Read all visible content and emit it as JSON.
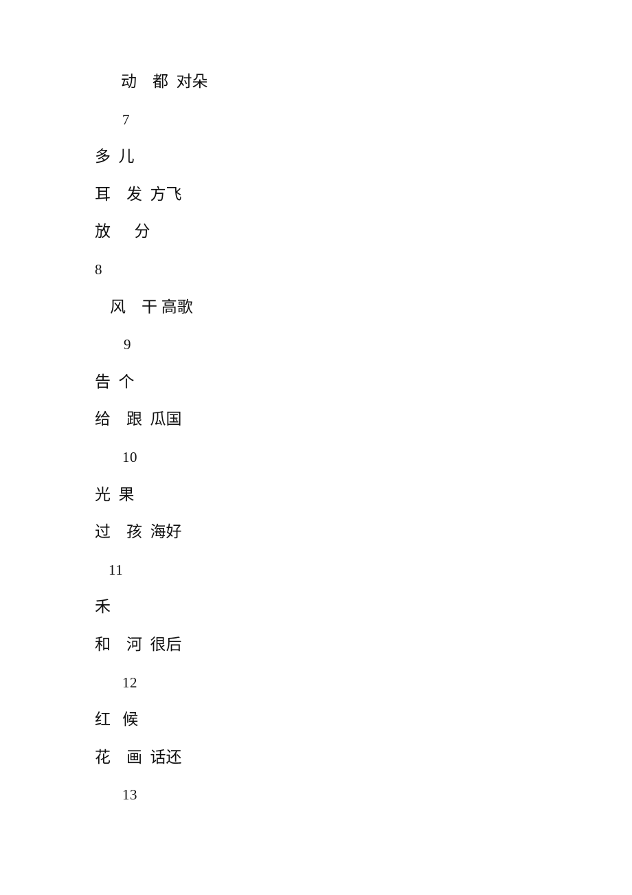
{
  "document": {
    "type": "character-list",
    "page_background": "#ffffff",
    "text_color": "#111111",
    "lines": [
      {
        "id": "line-1",
        "kind": "cjk",
        "indent": "ind-3",
        "text": "动    都  对朵"
      },
      {
        "id": "line-2",
        "kind": "num",
        "indent": "ind-4",
        "text": "7"
      },
      {
        "id": "line-3",
        "kind": "cjk",
        "indent": "ind-0",
        "text": "多  儿"
      },
      {
        "id": "line-4",
        "kind": "cjk",
        "indent": "ind-0",
        "text": "耳    发  方飞"
      },
      {
        "id": "line-5",
        "kind": "cjk",
        "indent": "ind-0",
        "text": "放      分"
      },
      {
        "id": "line-6",
        "kind": "num",
        "indent": "ind-0",
        "text": "8"
      },
      {
        "id": "line-7",
        "kind": "cjk",
        "indent": "ind-2",
        "text": "风    干 高歌"
      },
      {
        "id": "line-8",
        "kind": "num",
        "indent": "ind-5",
        "text": "9"
      },
      {
        "id": "line-9",
        "kind": "cjk",
        "indent": "ind-0",
        "text": "告  个"
      },
      {
        "id": "line-10",
        "kind": "cjk",
        "indent": "ind-0",
        "text": "给    跟  瓜国"
      },
      {
        "id": "line-11",
        "kind": "num",
        "indent": "ind-4",
        "text": "10"
      },
      {
        "id": "line-12",
        "kind": "cjk",
        "indent": "ind-0",
        "text": "光  果"
      },
      {
        "id": "line-13",
        "kind": "cjk",
        "indent": "ind-0",
        "text": "过    孩  海好"
      },
      {
        "id": "line-14",
        "kind": "num",
        "indent": "ind-1",
        "text": "11"
      },
      {
        "id": "line-15",
        "kind": "cjk",
        "indent": "ind-0",
        "text": "禾"
      },
      {
        "id": "line-16",
        "kind": "cjk",
        "indent": "ind-0",
        "text": "和    河  很后"
      },
      {
        "id": "line-17",
        "kind": "num",
        "indent": "ind-4",
        "text": "12"
      },
      {
        "id": "line-18",
        "kind": "cjk",
        "indent": "ind-0",
        "text": "红   候"
      },
      {
        "id": "line-19",
        "kind": "cjk",
        "indent": "ind-0",
        "text": "花    画  话还"
      },
      {
        "id": "line-20",
        "kind": "num",
        "indent": "ind-4",
        "text": "13"
      }
    ]
  }
}
